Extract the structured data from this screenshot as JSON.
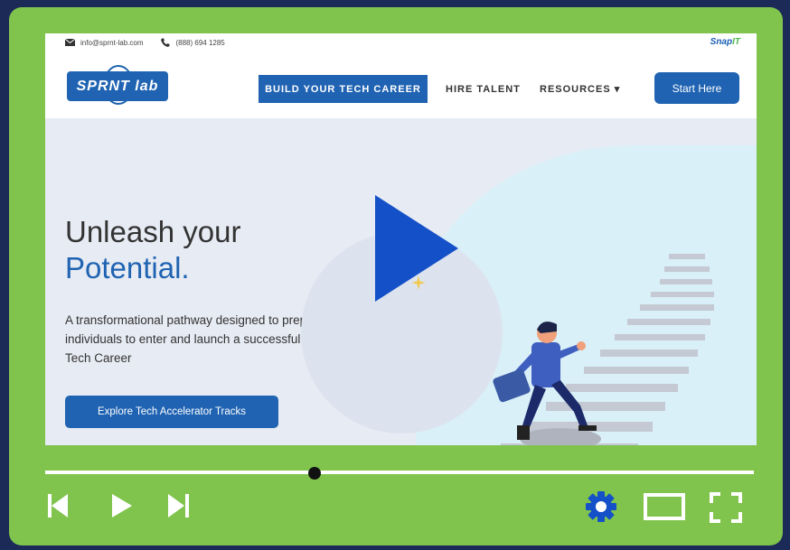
{
  "topbar": {
    "email": "info@sprnt-lab.com",
    "phone": "(888) 694 1285",
    "partner_logo_a": "Snap",
    "partner_logo_b": "IT"
  },
  "navbar": {
    "logo_text": "SPRNT lab",
    "items": [
      {
        "label": "BUILD YOUR TECH CAREER"
      },
      {
        "label": "HIRE TALENT"
      },
      {
        "label": "RESOURCES ▾"
      }
    ],
    "start_label": "Start Here"
  },
  "hero": {
    "headline_1": "Unleash your",
    "headline_2": "Potential.",
    "description": "A transformational pathway designed to prepare individuals to enter and launch a successful Tech Career",
    "cta_label": "Explore Tech Accelerator Tracks"
  },
  "player": {
    "progress": 0.38,
    "icons": [
      "skip-back-icon",
      "play-icon",
      "skip-forward-icon",
      "settings-gear-icon",
      "theater-mode-icon",
      "fullscreen-icon"
    ]
  },
  "colors": {
    "frame": "#80c44d",
    "background": "#1c2a58",
    "brand_blue": "#1f63b2"
  }
}
